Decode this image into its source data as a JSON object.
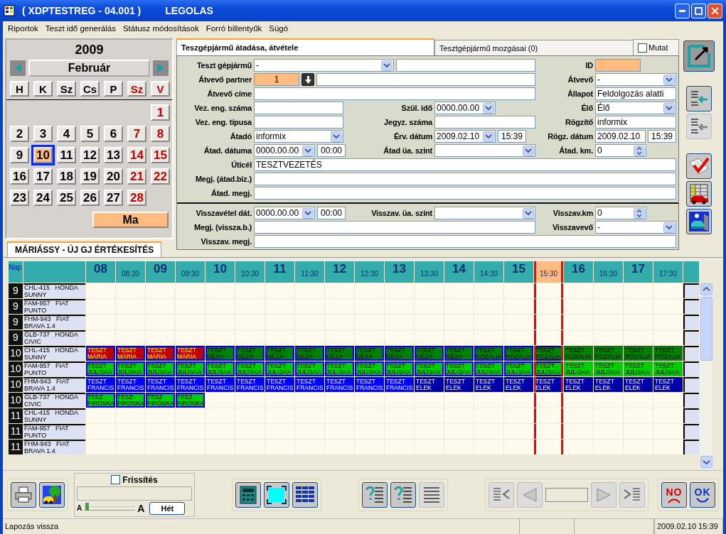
{
  "window": {
    "title": "( XDPTESTREG - 04.001 )",
    "subtitle": "LEGOLAS"
  },
  "menu": [
    "Riportok",
    "Teszt idő generálás",
    "Státusz módosítások",
    "Forró billentyűk",
    "Súgó"
  ],
  "calendar": {
    "year": "2009",
    "month": "Február",
    "weekdays": [
      {
        "label": "H",
        "weekend": false
      },
      {
        "label": "K",
        "weekend": false
      },
      {
        "label": "Sz",
        "weekend": false
      },
      {
        "label": "Cs",
        "weekend": false
      },
      {
        "label": "P",
        "weekend": false
      },
      {
        "label": "Sz",
        "weekend": true
      },
      {
        "label": "V",
        "weekend": true
      }
    ],
    "weeks": [
      [
        {
          "kind": "blank"
        },
        {
          "kind": "blank"
        },
        {
          "kind": "blank"
        },
        {
          "kind": "blank"
        },
        {
          "kind": "blank"
        },
        {
          "kind": "blank"
        },
        {
          "kind": "day",
          "day": "1",
          "weekend": true,
          "selected": false
        }
      ],
      [
        {
          "kind": "day",
          "day": "2",
          "weekend": false,
          "selected": false
        },
        {
          "kind": "day",
          "day": "3",
          "weekend": false,
          "selected": false
        },
        {
          "kind": "day",
          "day": "4",
          "weekend": false,
          "selected": false
        },
        {
          "kind": "day",
          "day": "5",
          "weekend": false,
          "selected": false
        },
        {
          "kind": "day",
          "day": "6",
          "weekend": false,
          "selected": false
        },
        {
          "kind": "day",
          "day": "7",
          "weekend": true,
          "selected": false
        },
        {
          "kind": "day",
          "day": "8",
          "weekend": true,
          "selected": false
        }
      ],
      [
        {
          "kind": "day",
          "day": "9",
          "weekend": false,
          "selected": false
        },
        {
          "kind": "day",
          "day": "10",
          "weekend": false,
          "selected": true
        },
        {
          "kind": "day",
          "day": "11",
          "weekend": false,
          "selected": false
        },
        {
          "kind": "day",
          "day": "12",
          "weekend": false,
          "selected": false
        },
        {
          "kind": "day",
          "day": "13",
          "weekend": false,
          "selected": false
        },
        {
          "kind": "day",
          "day": "14",
          "weekend": true,
          "selected": false
        },
        {
          "kind": "day",
          "day": "15",
          "weekend": true,
          "selected": false
        }
      ],
      [
        {
          "kind": "day",
          "day": "16",
          "weekend": false,
          "selected": false
        },
        {
          "kind": "day",
          "day": "17",
          "weekend": false,
          "selected": false
        },
        {
          "kind": "day",
          "day": "18",
          "weekend": false,
          "selected": false
        },
        {
          "kind": "day",
          "day": "19",
          "weekend": false,
          "selected": false
        },
        {
          "kind": "day",
          "day": "20",
          "weekend": false,
          "selected": false
        },
        {
          "kind": "day",
          "day": "21",
          "weekend": true,
          "selected": false
        },
        {
          "kind": "day",
          "day": "22",
          "weekend": true,
          "selected": false
        }
      ],
      [
        {
          "kind": "day",
          "day": "23",
          "weekend": false,
          "selected": false
        },
        {
          "kind": "day",
          "day": "24",
          "weekend": false,
          "selected": false
        },
        {
          "kind": "day",
          "day": "25",
          "weekend": false,
          "selected": false
        },
        {
          "kind": "day",
          "day": "26",
          "weekend": false,
          "selected": false
        },
        {
          "kind": "day",
          "day": "27",
          "weekend": false,
          "selected": false
        },
        {
          "kind": "day",
          "day": "28",
          "weekend": true,
          "selected": false
        }
      ]
    ],
    "today_button": "Ma"
  },
  "form_tabs": [
    {
      "label": "Teszgépjármű átadása, átvétele",
      "selected": true
    },
    {
      "label": "Tesztgépjármű mozgásai (0)",
      "selected": false
    }
  ],
  "show_checkbox": {
    "label": "Mutat",
    "checked": false
  },
  "form": {
    "handover_rows": [
      {
        "left": {
          "label": "Teszt gépjármű",
          "fields": [
            {
              "kind": "combo",
              "value": "-"
            },
            {
              "kind": "text"
            }
          ]
        },
        "right": {
          "label": "ID",
          "fields": [
            {
              "kind": "number"
            }
          ]
        }
      },
      {
        "left": {
          "label": "Átvevő partner",
          "fields": [
            {
              "kind": "number",
              "value": "1"
            },
            {
              "kind": "lookup"
            },
            {
              "kind": "text"
            }
          ]
        },
        "right": {
          "label": "Átvevő",
          "fields": [
            {
              "kind": "combo",
              "value": "-"
            }
          ]
        }
      },
      {
        "left": {
          "label": "Átvevő címe",
          "fields": [
            {
              "kind": "text"
            }
          ]
        },
        "right": {
          "label": "Állapot",
          "fields": [
            {
              "kind": "text",
              "value": "Feldolgozás alatti"
            }
          ]
        }
      },
      {
        "left": {
          "label": "Vez. eng. száma",
          "fields": [
            {
              "kind": "text"
            }
          ]
        },
        "middle": {
          "label": "Szül. idő",
          "fields": [
            {
              "kind": "date",
              "value": "0000.00.00"
            }
          ]
        },
        "right": {
          "label": "Élő",
          "fields": [
            {
              "kind": "combo",
              "value": "Élő"
            }
          ]
        }
      },
      {
        "left": {
          "label": "Vez. eng. típusa",
          "fields": [
            {
              "kind": "text"
            }
          ]
        },
        "middle": {
          "label": "Jegyz. száma",
          "fields": [
            {
              "kind": "text"
            }
          ]
        },
        "right": {
          "label": "Rögzítő",
          "fields": [
            {
              "kind": "text",
              "value": "informix"
            }
          ]
        }
      },
      {
        "left": {
          "label": "Átadó",
          "fields": [
            {
              "kind": "combo",
              "value": "informix"
            }
          ]
        },
        "middle": {
          "label": "Érv. dátum",
          "fields": [
            {
              "kind": "date",
              "value": "2009.02.10"
            },
            {
              "kind": "time",
              "value": "15:39"
            }
          ]
        },
        "right": {
          "label": "Rögz. dátum",
          "fields": [
            {
              "kind": "text",
              "value": "2009.02.10"
            },
            {
              "kind": "time",
              "value": "15:39"
            }
          ]
        }
      },
      {
        "left": {
          "label": "Átad. dátuma",
          "fields": [
            {
              "kind": "date",
              "value": "0000.00.00"
            },
            {
              "kind": "time",
              "value": "00:00"
            }
          ]
        },
        "middle": {
          "label": "Átad üa. szint",
          "fields": [
            {
              "kind": "combo"
            }
          ]
        },
        "right": {
          "label": "Átad. km.",
          "fields": [
            {
              "kind": "spin",
              "value": "0"
            }
          ]
        }
      },
      {
        "left": {
          "label": "Úticél",
          "fields": [
            {
              "kind": "text",
              "value": "TESZTVEZETÉS"
            }
          ]
        }
      },
      {
        "left": {
          "label": "Megj. (átad.biz.)",
          "fields": [
            {
              "kind": "text"
            }
          ]
        }
      },
      {
        "left": {
          "label": "Átad. megj.",
          "fields": [
            {
              "kind": "text"
            }
          ]
        }
      }
    ],
    "return_rows": [
      {
        "left": {
          "label": "Visszavétel dát.",
          "fields": [
            {
              "kind": "date",
              "value": "0000.00.00"
            },
            {
              "kind": "time",
              "value": "00:00"
            }
          ]
        },
        "middle": {
          "label": "Visszav. üa. szint",
          "fields": [
            {
              "kind": "combo"
            }
          ]
        },
        "right": {
          "label": "Visszav.km",
          "fields": [
            {
              "kind": "spin",
              "value": "0"
            }
          ]
        }
      },
      {
        "left": {
          "label": "Megj. (vissza.b.)",
          "fields": [
            {
              "kind": "text"
            }
          ]
        },
        "right": {
          "label": "Visszavevő",
          "fields": [
            {
              "kind": "combo",
              "value": "-"
            }
          ]
        }
      },
      {
        "left": {
          "label": "Visszav. megj.",
          "fields": [
            {
              "kind": "text"
            }
          ]
        }
      }
    ]
  },
  "side_toolbar": [
    {
      "kind": "edit",
      "disabled": false
    },
    {
      "kind": "list-in",
      "disabled": false
    },
    {
      "kind": "list-out",
      "disabled": true
    },
    {
      "kind": "checklist",
      "disabled": false
    },
    {
      "kind": "schedule",
      "disabled": false
    },
    {
      "kind": "garage",
      "disabled": false
    }
  ],
  "schedule_tabs": [
    {
      "label": "MÁRIÁSSY - ÚJ GJ ÉRTÉKESÍTÉS",
      "selected": true
    }
  ],
  "grid": {
    "day_header": "Nap",
    "columns": [
      {
        "label": "08",
        "kind": "hour",
        "selected": false
      },
      {
        "label": "08:30",
        "kind": "half",
        "selected": false
      },
      {
        "label": "09",
        "kind": "hour",
        "selected": false
      },
      {
        "label": "09:30",
        "kind": "half",
        "selected": false
      },
      {
        "label": "10",
        "kind": "hour",
        "selected": false
      },
      {
        "label": "10:30",
        "kind": "half",
        "selected": false
      },
      {
        "label": "11",
        "kind": "hour",
        "selected": false
      },
      {
        "label": "11:30",
        "kind": "half",
        "selected": false
      },
      {
        "label": "12",
        "kind": "hour",
        "selected": false
      },
      {
        "label": "12:30",
        "kind": "half",
        "selected": false
      },
      {
        "label": "13",
        "kind": "hour",
        "selected": false
      },
      {
        "label": "13:30",
        "kind": "half",
        "selected": false
      },
      {
        "label": "14",
        "kind": "hour",
        "selected": false
      },
      {
        "label": "14:30",
        "kind": "half",
        "selected": false
      },
      {
        "label": "15",
        "kind": "hour",
        "selected": false
      },
      {
        "label": "15:30",
        "kind": "half",
        "selected": true
      },
      {
        "label": "16",
        "kind": "hour",
        "selected": false
      },
      {
        "label": "16:30",
        "kind": "half",
        "selected": false
      },
      {
        "label": "17",
        "kind": "hour",
        "selected": false
      },
      {
        "label": "17:30",
        "kind": "half",
        "selected": false
      }
    ],
    "rows": [
      {
        "day": "9",
        "plate": "CHL-415",
        "make": "HONDA",
        "model": "SUNNY",
        "slots": []
      },
      {
        "day": "9",
        "plate": "FAM-957",
        "make": "FIAT",
        "model": "PUNTO",
        "slots": []
      },
      {
        "day": "9",
        "plate": "FHM-943",
        "make": "FIAT",
        "model": "BRAVA 1.4",
        "slots": []
      },
      {
        "day": "9",
        "plate": "GLB-737",
        "make": "HONDA",
        "model": "CIVIC",
        "slots": []
      },
      {
        "day": "10",
        "plate": "CHL-415",
        "make": "HONDA",
        "model": "SUNNY",
        "slots": [
          {
            "line1": "TESZT",
            "line2": "MÁRIA",
            "color": "#c00000",
            "outlined": true
          },
          {
            "line1": "TESZT",
            "line2": "MÁRIA",
            "color": "#c00000",
            "outlined": true
          },
          {
            "line1": "TESZT",
            "line2": "MÁRIA",
            "color": "#c00000",
            "outlined": true
          },
          {
            "line1": "TESZT",
            "line2": "MÁRIA",
            "color": "#c00000",
            "outlined": true
          },
          {
            "line1": "TESZT",
            "line2": "GÉZA",
            "color": "#008000",
            "outlined": true
          },
          {
            "line1": "TESZT",
            "line2": "GÉZA",
            "color": "#008000",
            "outlined": true
          },
          {
            "line1": "TESZT",
            "line2": "GÉZA",
            "color": "#008000",
            "outlined": true
          },
          {
            "line1": "TESZT",
            "line2": "GÉZA",
            "color": "#008000",
            "outlined": true
          },
          {
            "line1": "TESZT",
            "line2": "GÉZA",
            "color": "#008000",
            "outlined": true
          },
          {
            "line1": "TESZT",
            "line2": "GÉZA",
            "color": "#008000",
            "outlined": true
          },
          {
            "line1": "TESZT",
            "line2": "GÉZA",
            "color": "#008000",
            "outlined": true
          },
          {
            "line1": "TESZT",
            "line2": "GÉZA",
            "color": "#008000",
            "outlined": true
          },
          {
            "line1": "TESZT",
            "line2": "GÉZA",
            "color": "#008000",
            "outlined": true
          },
          {
            "line1": "TESZT",
            "line2": "ROZÁLIA",
            "color": "#008000",
            "outlined": true
          },
          {
            "line1": "TESZT",
            "line2": "ROZÁLIA",
            "color": "#008000",
            "outlined": true
          },
          {
            "line1": "TESZT",
            "line2": "ROZÁLIA",
            "color": "#008000",
            "outlined": true
          },
          {
            "line1": "TESZT",
            "line2": "ROZÁLIA",
            "color": "#008000",
            "outlined": false
          },
          {
            "line1": "TESZT",
            "line2": "ROZÁLIA",
            "color": "#008000",
            "outlined": false
          },
          {
            "line1": "TESZT",
            "line2": "ROZÁLIA",
            "color": "#008000",
            "outlined": false
          },
          {
            "line1": "TESZT",
            "line2": "ROZÁLIA",
            "color": "#008000",
            "outlined": false
          }
        ]
      },
      {
        "day": "10",
        "plate": "FAM-957",
        "make": "FIAT",
        "model": "PUNTO",
        "slots": [
          {
            "line1": "TESZT",
            "line2": "JULISKA",
            "color": "#00cc00",
            "outlined": true
          },
          {
            "line1": "TESZT",
            "line2": "JULISKA",
            "color": "#00cc00",
            "outlined": true
          },
          {
            "line1": "TESZT",
            "line2": "JULISKA",
            "color": "#00cc00",
            "outlined": true
          },
          {
            "line1": "TESZT",
            "line2": "JULISKA",
            "color": "#00cc00",
            "outlined": true
          },
          {
            "line1": "TESZT",
            "line2": "JULISKA",
            "color": "#00cc00",
            "outlined": true
          },
          {
            "line1": "TESZT",
            "line2": "JULISKA",
            "color": "#00cc00",
            "outlined": true
          },
          {
            "line1": "TESZT",
            "line2": "JULISKA",
            "color": "#00cc00",
            "outlined": true
          },
          {
            "line1": "TESZT",
            "line2": "JULISKA",
            "color": "#00cc00",
            "outlined": true
          },
          {
            "line1": "TESZT",
            "line2": "JULISKA",
            "color": "#00cc00",
            "outlined": true
          },
          {
            "line1": "TESZT",
            "line2": "JULISKA",
            "color": "#00cc00",
            "outlined": true
          },
          {
            "line1": "TESZT",
            "line2": "JULISKA",
            "color": "#00cc00",
            "outlined": true
          },
          {
            "line1": "TESZT",
            "line2": "JULISKA",
            "color": "#00cc00",
            "outlined": true
          },
          {
            "line1": "TESZT",
            "line2": "JULISKA",
            "color": "#00cc00",
            "outlined": true
          },
          {
            "line1": "TESZT",
            "line2": "JULISKA",
            "color": "#00cc00",
            "outlined": true
          },
          {
            "line1": "TESZT",
            "line2": "JULISKA",
            "color": "#00cc00",
            "outlined": true
          },
          {
            "line1": "TESZT",
            "line2": "JULISKA",
            "color": "#00cc00",
            "outlined": true
          },
          {
            "line1": "TESZT",
            "line2": "JULISKA",
            "color": "#00cc00",
            "outlined": false
          },
          {
            "line1": "TESZT",
            "line2": "JULISKA",
            "color": "#00cc00",
            "outlined": false
          },
          {
            "line1": "TESZT",
            "line2": "JULISKA",
            "color": "#00cc00",
            "outlined": false
          },
          {
            "line1": "TESZT",
            "line2": "JULISKA",
            "color": "#00cc00",
            "outlined": false
          }
        ]
      },
      {
        "day": "10",
        "plate": "FHM-943",
        "make": "FIAT",
        "model": "BRAVA 1.4",
        "slots": [
          {
            "line1": "TESZT",
            "line2": "FRANCIS",
            "color": "#0000ff"
          },
          {
            "line1": "TESZT",
            "line2": "FRANCIS",
            "color": "#0000ff"
          },
          {
            "line1": "TESZT",
            "line2": "FRANCIS",
            "color": "#0000ff"
          },
          {
            "line1": "TESZT",
            "line2": "FRANCIS",
            "color": "#0000ff"
          },
          {
            "line1": "TESZT",
            "line2": "FRANCIS",
            "color": "#0000ff"
          },
          {
            "line1": "TESZT",
            "line2": "FRANCIS",
            "color": "#0000ff"
          },
          {
            "line1": "TESZT",
            "line2": "FRANCIS",
            "color": "#0000ff"
          },
          {
            "line1": "TESZT",
            "line2": "FRANCIS",
            "color": "#0000ff"
          },
          {
            "line1": "TESZT",
            "line2": "FRANCIS",
            "color": "#0000ff"
          },
          {
            "line1": "TESZT",
            "line2": "FRANCIS",
            "color": "#0000ff"
          },
          {
            "line1": "TESZT",
            "line2": "FRANCIS",
            "color": "#0000ff"
          },
          {
            "line1": "TESZT",
            "line2": "ELEK",
            "color": "#0000a8"
          },
          {
            "line1": "TESZT",
            "line2": "ELEK",
            "color": "#0000a8"
          },
          {
            "line1": "TESZT",
            "line2": "ELEK",
            "color": "#0000a8"
          },
          {
            "line1": "TESZT",
            "line2": "ELEK",
            "color": "#0000a8"
          },
          {
            "line1": "TESZT",
            "line2": "ELEK",
            "color": "#0000a8"
          },
          {
            "line1": "TESZT",
            "line2": "ELEK",
            "color": "#0000a8"
          },
          {
            "line1": "TESZT",
            "line2": "ELEK",
            "color": "#0000a8"
          },
          {
            "line1": "TESZT",
            "line2": "ELEK",
            "color": "#0000a8"
          },
          {
            "line1": "TESZT",
            "line2": "ELEK",
            "color": "#0000a8"
          }
        ]
      },
      {
        "day": "10",
        "plate": "GLB-737",
        "make": "HONDA",
        "model": "CIVIC",
        "slots": [
          {
            "line1": "TESZ",
            "line2": "PIROSKA",
            "color": "#00cc00",
            "outlined": true
          },
          {
            "line1": "TESZ",
            "line2": "PIROSKA",
            "color": "#00cc00",
            "outlined": true
          },
          {
            "line1": "TESZ",
            "line2": "PIROSKA",
            "color": "#00cc00",
            "outlined": true
          },
          {
            "line1": "TESZ",
            "line2": "PIROSKA",
            "color": "#00cc00",
            "outlined": true
          }
        ]
      },
      {
        "day": "11",
        "plate": "CHL-415",
        "make": "HONDA",
        "model": "SUNNY",
        "slots": []
      },
      {
        "day": "11",
        "plate": "FAM-957",
        "make": "FIAT",
        "model": "PUNTO",
        "slots": []
      },
      {
        "day": "11",
        "plate": "FHM-943",
        "make": "FIAT",
        "model": "BRAVA 1.4",
        "slots": []
      }
    ]
  },
  "bottom_toolbar": {
    "left": [
      {
        "kind": "print",
        "disabled": false
      },
      {
        "kind": "picture",
        "disabled": false
      }
    ],
    "refresh": {
      "label": "Frissítés",
      "checked": false,
      "small_a": "A",
      "large_a": "A",
      "level": 0.03,
      "week_button": "Hét"
    },
    "view": [
      {
        "kind": "calculator",
        "disabled": false
      },
      {
        "kind": "fullscreen",
        "disabled": false
      },
      {
        "kind": "grid",
        "disabled": false
      }
    ],
    "help": [
      {
        "kind": "help-list",
        "disabled": false
      },
      {
        "kind": "help-list",
        "disabled": false
      },
      {
        "kind": "list",
        "disabled": true
      }
    ],
    "nav": [
      {
        "kind": "first",
        "disabled": true
      },
      {
        "kind": "prev",
        "disabled": true
      },
      {
        "kind": "page"
      },
      {
        "kind": "next",
        "disabled": true
      },
      {
        "kind": "last",
        "disabled": true
      }
    ],
    "confirm": [
      {
        "kind": "no",
        "label": "NO"
      },
      {
        "kind": "ok",
        "label": "OK"
      }
    ]
  },
  "status_bar": {
    "message": "Lapozás vissza",
    "time": "2009.02.10 15:39"
  }
}
